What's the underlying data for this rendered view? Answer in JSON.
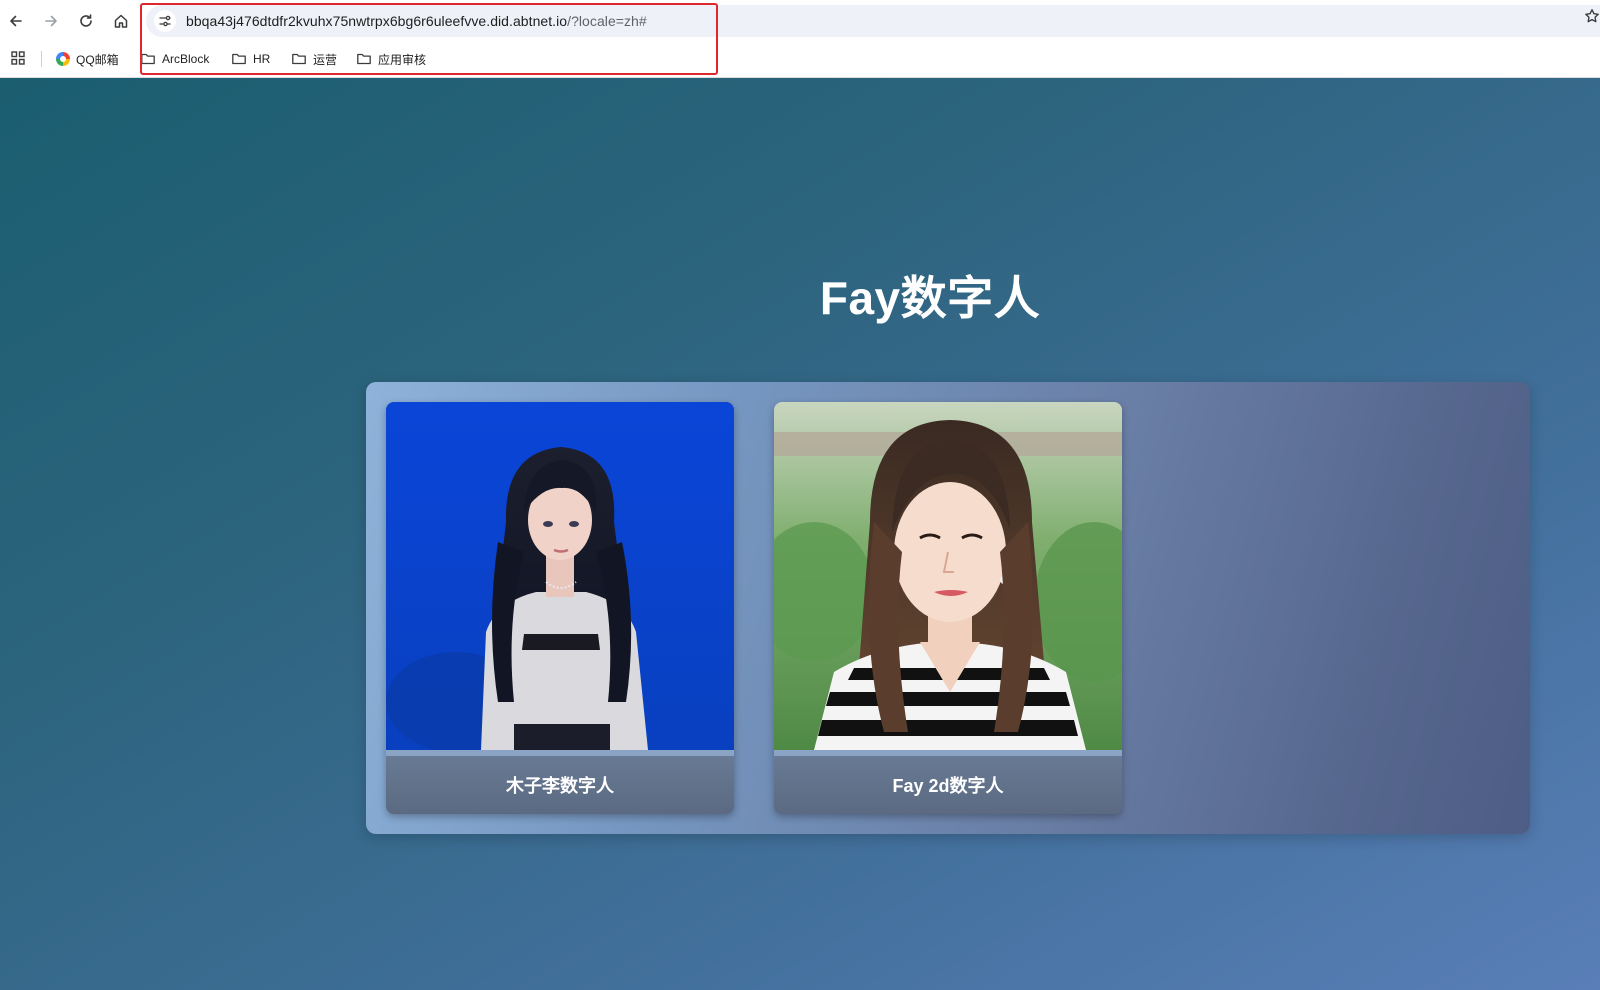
{
  "browser": {
    "url_main": "bbqa43j476dtdfr2kvuhx75nwtrpx6bg6r6uleefvve.did.abtnet.io",
    "url_rest": "/?locale=zh#",
    "icons": {
      "back": "arrow-left-icon",
      "forward": "arrow-right-icon",
      "reload": "reload-icon",
      "home": "home-icon",
      "site_info": "tune-icon",
      "bookmark": "star-icon",
      "apps": "grid-icon"
    }
  },
  "bookmarks": [
    {
      "label": "QQ邮箱",
      "icon": "qq-mail-logo-icon"
    },
    {
      "label": "ArcBlock",
      "icon": "folder-icon"
    },
    {
      "label": "HR",
      "icon": "folder-icon"
    },
    {
      "label": "运营",
      "icon": "folder-icon"
    },
    {
      "label": "应用审核",
      "icon": "folder-icon"
    }
  ],
  "page": {
    "title": "Fay数字人",
    "cards": [
      {
        "label": "木子李数字人"
      },
      {
        "label": "Fay 2d数字人"
      }
    ]
  },
  "colors": {
    "highlight": "#e0272e",
    "page_gradient_start": "#1b5e70",
    "page_gradient_end": "#5a7fb8",
    "card_label_bg": "#64758f"
  }
}
